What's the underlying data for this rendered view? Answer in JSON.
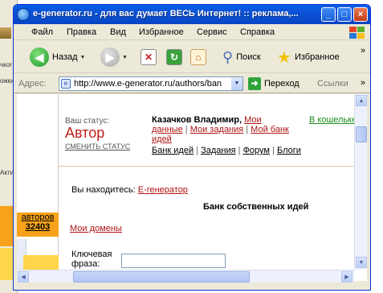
{
  "window": {
    "title": "e-generator.ru - для вас думает ВЕСЬ Интернет! :: реклама,...",
    "controls": [
      "minimize",
      "maximize",
      "close"
    ]
  },
  "menu": [
    "Файл",
    "Правка",
    "Вид",
    "Избранное",
    "Сервис",
    "Справка"
  ],
  "toolbar": {
    "back_label": "Назад",
    "search_label": "Поиск",
    "favorites_label": "Избранное",
    "overflow": "»"
  },
  "address": {
    "label": "Адрес:",
    "value": "http://www.e-generator.ru/authors/ban",
    "go_label": "Переход",
    "links_label": "Ссылки",
    "overflow": "»"
  },
  "page": {
    "status_label": "Ваш статус:",
    "status_value": "Автор",
    "change_status": "СМЕНИТЬ СТАТУС",
    "user_name": "Казачков Владимир,",
    "links_line1": "Мои",
    "links_line2a": "данные",
    "links_line2b": "Мои задания",
    "links_line2c": "Мой банк",
    "links_line3": "идей",
    "nav": [
      "Банк идей",
      "Задания",
      "Форум",
      "Блоги"
    ],
    "wallet": "В кошельке",
    "you_are_here_label": "Вы находитесь:",
    "you_are_here_link": "Е-генератор",
    "bank_title": "Банк собственных идей",
    "my_domains": "Мои домены",
    "keyword_label": "Ключевая фраза:",
    "keyword_value": "",
    "authors_label": "авторов",
    "authors_count": "32403"
  },
  "background_window": {
    "text_1": "чкоr",
    "text_2": "ожки",
    "text_3": "Акти"
  },
  "colors": {
    "title_bar": "#0a52d6",
    "status_red": "#c0201a",
    "link_red": "#b01212",
    "wallet_green": "#1a8a1a",
    "authors_orange": "#f7a21a"
  }
}
